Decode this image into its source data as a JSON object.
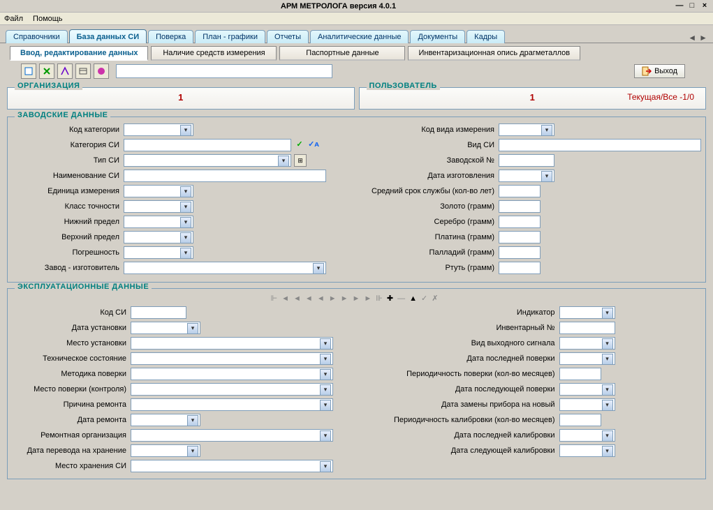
{
  "title": "АРМ МЕТРОЛОГА версия 4.0.1",
  "menu": {
    "file": "Файл",
    "help": "Помощь"
  },
  "tabs": {
    "items": [
      "Справочники",
      "База данных  СИ",
      "Поверка",
      "План - графики",
      "Отчеты",
      "Аналитические данные",
      "Документы",
      "Кадры"
    ],
    "active": 1
  },
  "subtabs": {
    "items": [
      "Ввод, редактирование данных",
      "Наличие средств измерения",
      "Паспортные данные",
      "Инвентаризационная опись драгметаллов"
    ],
    "active": 0
  },
  "toolbar": {
    "exit": "Выход"
  },
  "org": {
    "legend": "ОРГАНИЗАЦИЯ",
    "value": "1"
  },
  "user": {
    "legend": "ПОЛЬЗОВАТЕЛЬ",
    "value": "1",
    "current": "Текущая/Все   -1/0"
  },
  "factory": {
    "legend": "ЗАВОДСКИЕ ДАННЫЕ",
    "left": {
      "l0": "Код категории",
      "l1": "Категория СИ",
      "l2": "Тип СИ",
      "l3": "Наименование СИ",
      "l4": "Единица измерения",
      "l5": "Класс точности",
      "l6": "Нижний предел",
      "l7": "Верхний предел",
      "l8": "Погрешность",
      "l9": "Завод - изготовитель"
    },
    "right": {
      "r0": "Код вида измерения",
      "r1": "Вид СИ",
      "r2": "Заводской №",
      "r3": "Дата изготовления",
      "r4": "Средний срок службы (кол-во лет)",
      "r5": "Золото (грамм)",
      "r6": "Серебро (грамм)",
      "r7": "Платина (грамм)",
      "r8": "Палладий (грамм)",
      "r9": "Ртуть (грамм)"
    }
  },
  "expl": {
    "legend": "ЭКСПЛУАТАЦИОННЫЕ ДАННЫЕ",
    "left": {
      "e0": "Код СИ",
      "e1": "Дата установки",
      "e2": "Место установки",
      "e3": "Техническое состояние",
      "e4": "Методика поверки",
      "e5": "Место поверки (контроля)",
      "e6": "Причина ремонта",
      "e7": "Дата ремонта",
      "e8": "Ремонтная организация",
      "e9": "Дата перевода на хранение",
      "e10": "Место хранения СИ"
    },
    "right": {
      "r0": "Индикатор",
      "r1": "Инвентарный №",
      "r2": "Вид выходного сигнала",
      "r3": "Дата последней поверки",
      "r4": "Периодичность поверки (кол-во месяцев)",
      "r5": "Дата последующей поверки",
      "r6": "Дата замены прибора на новый",
      "r7": "Периодичность калибровки (кол-во месяцев)",
      "r8": "Дата последней калибровки",
      "r9": "Дата следующей калибровки"
    }
  }
}
